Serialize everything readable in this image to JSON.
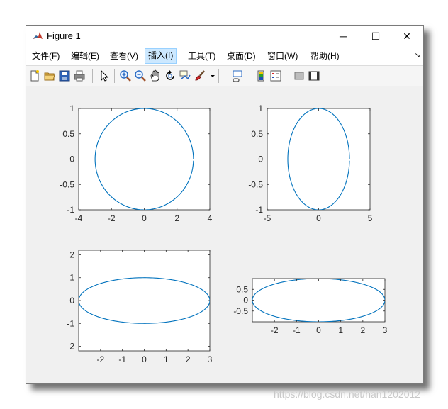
{
  "window": {
    "title": "Figure 1",
    "controls": [
      "─",
      "☐",
      "✕"
    ]
  },
  "menubar": {
    "items": [
      {
        "label": "文件(F)",
        "active": false
      },
      {
        "label": "编辑(E)",
        "active": false
      },
      {
        "label": "查看(V)",
        "active": false
      },
      {
        "label": "插入(I)",
        "active": true
      },
      {
        "label": "工具(T)",
        "active": false
      },
      {
        "label": "桌面(D)",
        "active": false
      },
      {
        "label": "窗口(W)",
        "active": false
      },
      {
        "label": "帮助(H)",
        "active": false
      }
    ],
    "overflow_icon": "dock-arrow-icon"
  },
  "toolbar": {
    "icons": [
      "new-figure-icon",
      "open-file-icon",
      "save-icon",
      "print-icon",
      "edit-plot-arrow-icon",
      "zoom-in-icon",
      "zoom-out-icon",
      "pan-hand-icon",
      "rotate-3d-icon",
      "data-cursor-icon",
      "brush-icon",
      "brush-dropdown-icon",
      "link-plot-icon",
      "colorbar-icon",
      "legend-icon",
      "hide-plot-tools-icon",
      "show-plot-tools-icon"
    ]
  },
  "chart_data": [
    {
      "type": "line",
      "curve": "x = 3cos(t), y = sin(t)",
      "xlim": [
        -4,
        4
      ],
      "ylim": [
        -1,
        1
      ],
      "xticks": [
        "-4",
        "-2",
        "0",
        "2",
        "4"
      ],
      "yticks": [
        "1",
        "0.5",
        "0",
        "-0.5",
        "-1"
      ],
      "series": [
        {
          "a": 3,
          "b": 1,
          "color": "#0072bd"
        }
      ]
    },
    {
      "type": "line",
      "curve": "x = 3cos(t), y = sin(t)",
      "xlim": [
        -5,
        5
      ],
      "ylim": [
        -1,
        1
      ],
      "xticks": [
        "-5",
        "0",
        "5"
      ],
      "yticks": [
        "1",
        "0.5",
        "0",
        "-0.5",
        "-1"
      ],
      "series": [
        {
          "a": 3,
          "b": 1,
          "color": "#0072bd"
        }
      ]
    },
    {
      "type": "line",
      "curve": "x = 3cos(t), y = sin(t)",
      "xlim": [
        -3,
        3
      ],
      "ylim": [
        -2.2,
        2.2
      ],
      "xticks": [
        "-2",
        "-1",
        "0",
        "1",
        "2",
        "3"
      ],
      "yticks": [
        "2",
        "1",
        "0",
        "-1",
        "-2"
      ],
      "series": [
        {
          "a": 3,
          "b": 1,
          "color": "#0072bd"
        }
      ]
    },
    {
      "type": "line",
      "curve": "x = 3cos(t), y = sin(t)",
      "xlim": [
        -3,
        3
      ],
      "ylim": [
        -1,
        1
      ],
      "xticks": [
        "-2",
        "-1",
        "0",
        "1",
        "2",
        "3"
      ],
      "yticks": [
        "0.5",
        "0",
        "-0.5"
      ],
      "series": [
        {
          "a": 3,
          "b": 1,
          "color": "#0072bd"
        }
      ]
    }
  ],
  "watermark": "https://blog.csdn.net/han1202012"
}
